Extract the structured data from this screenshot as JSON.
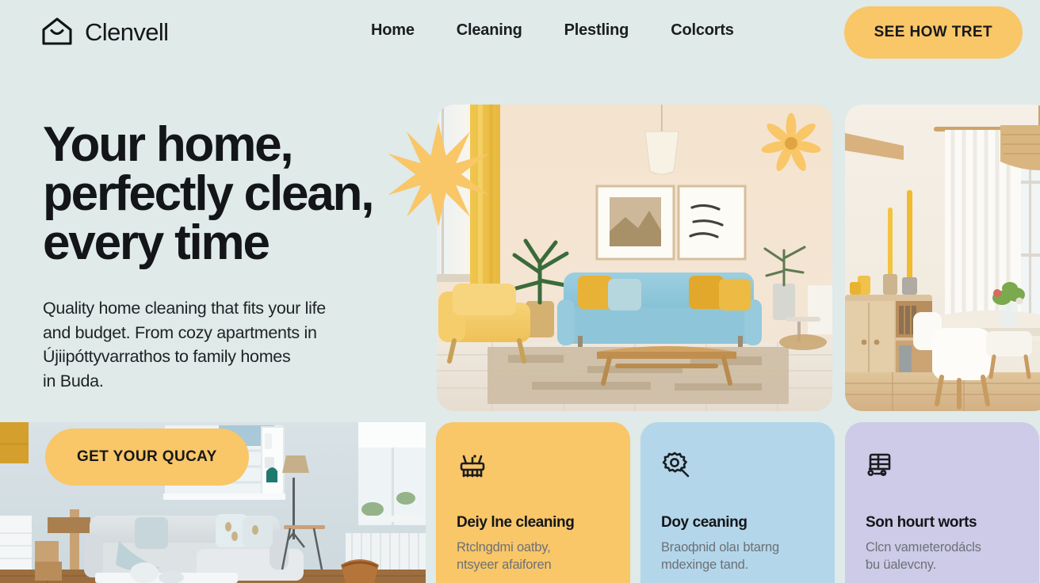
{
  "brand": {
    "name": "Clenvell",
    "logo_icon": "house-smile-icon"
  },
  "nav": {
    "items": [
      {
        "label": "Home"
      },
      {
        "label": "Cleaning"
      },
      {
        "label": "Plestling"
      },
      {
        "label": "Colcorts"
      }
    ]
  },
  "header": {
    "cta_label": "SEE HOW TRET"
  },
  "hero": {
    "title": "Your home,\nperfectly clean,\nevery time",
    "subtitle": "Quality home cleaning that fits your life\nand budget. From cozy apartments in\nÚjiipóttyvarrathos to family homes\nin Buda.",
    "cta_label": "GET YOUR QUCAY",
    "decor": {
      "starburst_icon": "starburst-icon",
      "daisy_icon": "daisy-flower-icon"
    },
    "images": [
      {
        "alt": "living-room-blue-sofa"
      },
      {
        "alt": "dining-room-wood-sideboard"
      },
      {
        "alt": "grey-sectional-living-room"
      }
    ]
  },
  "features": {
    "cards": [
      {
        "icon": "scrub-brush-icon",
        "title": "Deiy lne cleaning",
        "body": "Rtclngdmi oatby,\nntsyeer afaiforen",
        "color": "#f9c668"
      },
      {
        "icon": "magnifier-flower-icon",
        "title": "Doy ceaning",
        "body": "Braофnid olaı btarng\nmdexinge tand.",
        "color": "#b3d6ea"
      },
      {
        "icon": "cleaning-cart-icon",
        "title": "Son houгt worts",
        "body": "Clcn vamıeterodácls\nƅu üalevcny.",
        "color": "#cdcbe8"
      }
    ]
  },
  "theme": {
    "page_background": "#dfeae9",
    "accent_yellow": "#f9c668",
    "accent_blue": "#b3d6ea",
    "accent_purple": "#cdcbe8",
    "text_dark": "#141619",
    "text_muted": "#6d7176"
  }
}
